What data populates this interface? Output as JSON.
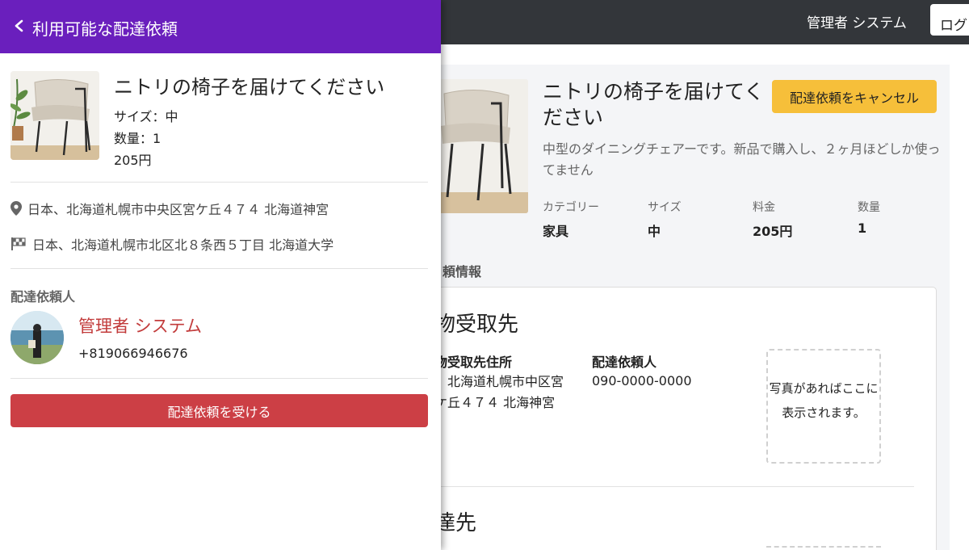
{
  "header": {
    "user_name": "管理者 システム",
    "logout_label": "ログ"
  },
  "detail": {
    "title": "ニトリの椅子を届けてください",
    "cancel_label": "配達依頼をキャンセル",
    "description": "中型のダイニングチェアーです。新品で購入し、２ヶ月ほどしか使ってません",
    "specs": [
      {
        "label": "カテゴリー",
        "value": "家具"
      },
      {
        "label": "サイズ",
        "value": "中"
      },
      {
        "label": "料金",
        "value": "205円"
      },
      {
        "label": "数量",
        "value": "1"
      }
    ],
    "section_label": "頼情報",
    "pickup_heading": "物受取先",
    "pickup_address_label": "物受取先住所",
    "pickup_address": "、北海道札幌市中区宮ケ丘４７４ 北海神宮",
    "requester_label": "配達依頼人",
    "requester_phone": "090-0000-0000",
    "photo_placeholder": "写真があればここに表示されます。",
    "destination_heading": "達先"
  },
  "drawer": {
    "title": "利用可能な配達依頼",
    "item": {
      "title": "ニトリの椅子を届けてください",
      "size": "サイズ：中",
      "quantity": "数量：1",
      "price": "205円"
    },
    "pickup_address": "日本、北海道札幌市中央区宮ケ丘４７４ 北海道神宮",
    "destination_address": "日本、北海道札幌市北区北８条西５丁目 北海道大学",
    "requester_section_label": "配達依頼人",
    "requester_name": "管理者 システム",
    "requester_phone": "+819066946676",
    "accept_label": "配達依頼を受ける"
  },
  "colors": {
    "drawer_header": "#6a1fbd",
    "accept_button": "#cc3f45",
    "cancel_button": "#f6bf3a",
    "requester_name": "#c23b3b",
    "topbar": "#33363a"
  },
  "icons": [
    "chevron-left-icon",
    "map-marker-icon",
    "checkered-flag-icon"
  ]
}
